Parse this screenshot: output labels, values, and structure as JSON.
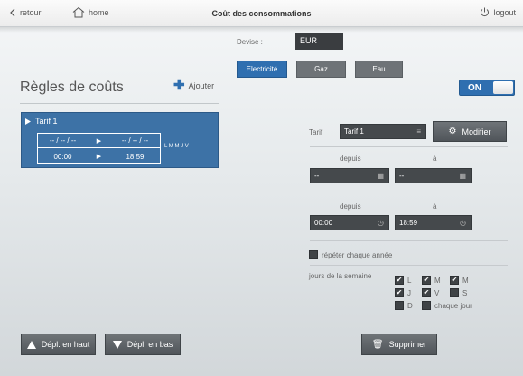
{
  "topbar": {
    "back_label": "retour",
    "home_label": "home",
    "title": "Coût des consommations",
    "logout_label": "logout"
  },
  "left": {
    "title": "Règles de coûts",
    "add_label": "Ajouter",
    "tarif": {
      "name": "Tarif 1",
      "date_from": "-- / -- / --",
      "date_to": "-- / -- / --",
      "time_from": "00:00",
      "time_to": "18:59",
      "days": "L M M J V - -"
    },
    "move_up_label": "Dépl. en haut",
    "move_down_label": "Dépl. en bas"
  },
  "right": {
    "devise_label": "Devise :",
    "devise_value": "EUR",
    "tabs": [
      {
        "label": "Electricité",
        "active": true
      },
      {
        "label": "Gaz",
        "active": false
      },
      {
        "label": "Eau",
        "active": false
      }
    ],
    "toggle_label": "ON",
    "tarif_label": "Tarif",
    "tarif_value": "Tarif 1",
    "modify_label": "Modifier",
    "depuis_label": "depuis",
    "a_label": "à",
    "date_from_value": "--",
    "date_to_value": "--",
    "time_from_value": "00:00",
    "time_to_value": "18:59",
    "repeat_label": "répéter chaque année",
    "week_label": "jours de la semaine",
    "days": [
      {
        "label": "L",
        "checked": true
      },
      {
        "label": "M",
        "checked": true
      },
      {
        "label": "M",
        "checked": true
      },
      {
        "label": "J",
        "checked": true
      },
      {
        "label": "V",
        "checked": true
      },
      {
        "label": "S",
        "checked": false
      },
      {
        "label": "D",
        "checked": false
      }
    ],
    "every_day_label": "chaque jour",
    "delete_label": "Supprimer"
  },
  "colors": {
    "accent": "#2f6fb0",
    "card": "#3d72a6",
    "dark_field": "#45494c",
    "dark_button": "#5d6266"
  }
}
